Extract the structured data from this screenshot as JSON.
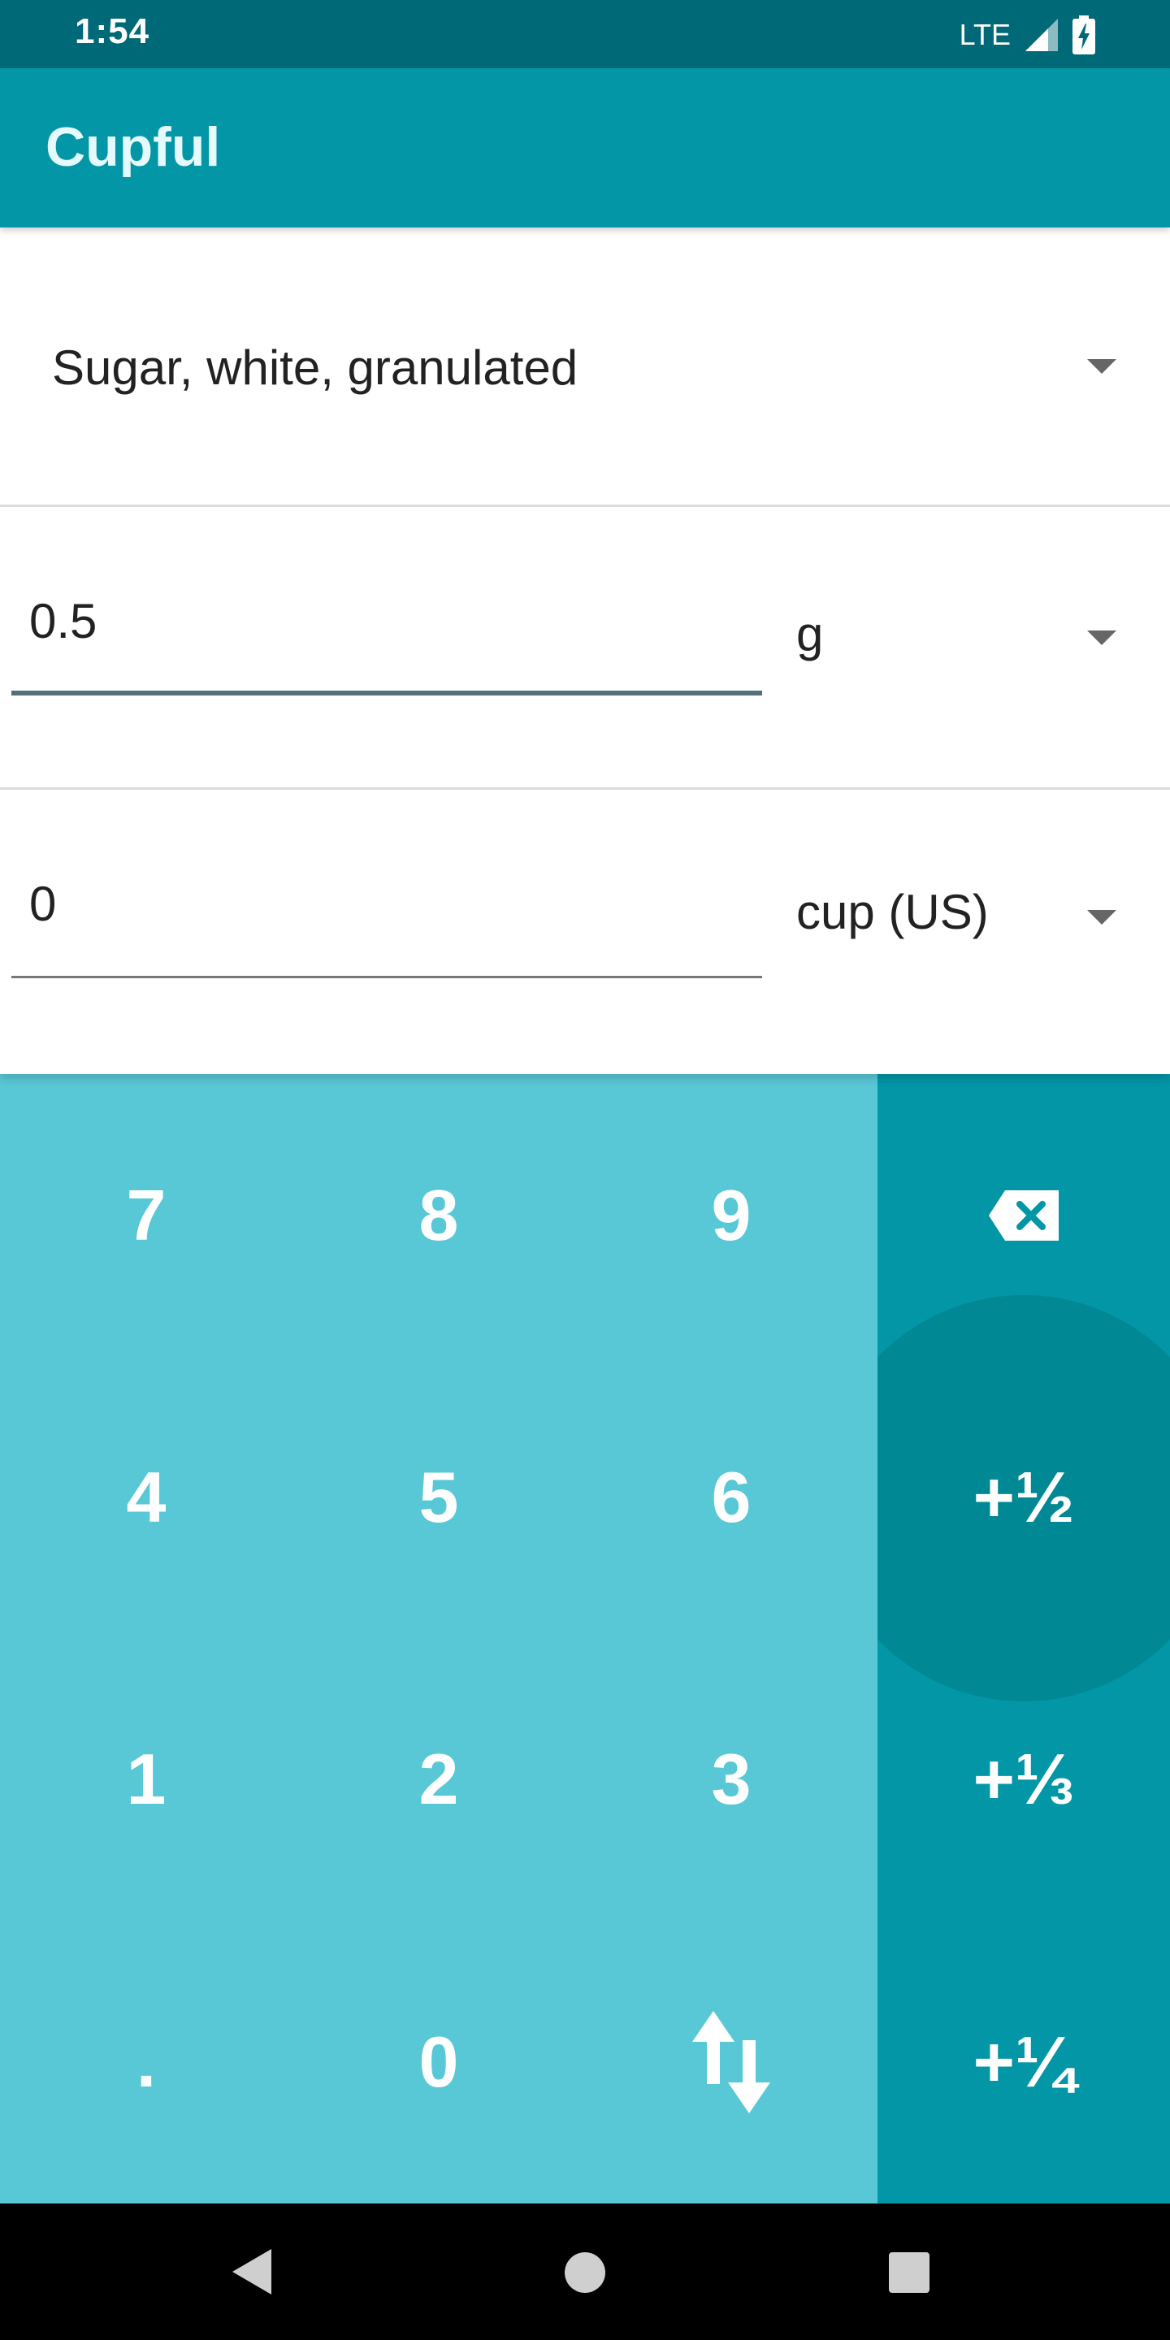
{
  "status_bar": {
    "time": "1:54",
    "network": "LTE"
  },
  "app_bar": {
    "title": "Cupful"
  },
  "ingredient": {
    "selected": "Sugar, white, granulated"
  },
  "conversion": {
    "from": {
      "value": "0.5",
      "unit": "g"
    },
    "to": {
      "value": "0",
      "unit": "cup (US)"
    }
  },
  "keypad": {
    "digit_rows": [
      [
        "7",
        "8",
        "9"
      ],
      [
        "4",
        "5",
        "6"
      ],
      [
        "1",
        "2",
        "3"
      ]
    ],
    "decimal": ".",
    "zero": "0",
    "fractions": [
      "+½",
      "+⅓",
      "+¼"
    ]
  },
  "icons": {
    "dropdown": "chevron-down-icon",
    "backspace": "backspace-icon",
    "swap": "swap-vertical-icon",
    "signal": "signal-icon",
    "battery": "battery-charging-icon",
    "nav_back": "back-icon",
    "nav_home": "home-icon",
    "nav_recents": "recents-icon"
  },
  "colors": {
    "status_bar": "#006977",
    "app_bar": "#0296a6",
    "keypad_numbers": "#58c7d6",
    "keypad_side": "#0296a6",
    "ripple": "#008894",
    "focused_underline": "#546e7a"
  }
}
